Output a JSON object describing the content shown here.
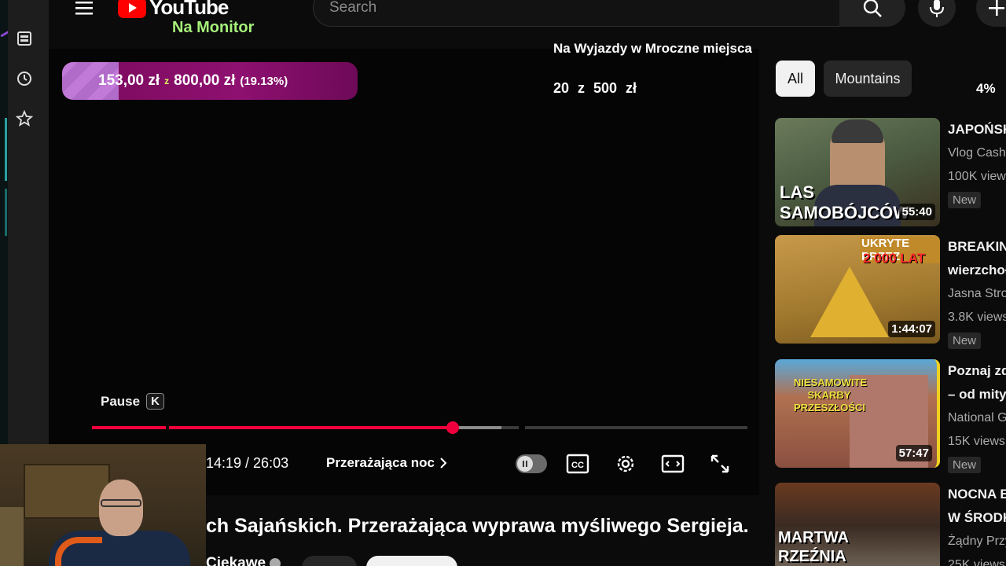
{
  "header": {
    "logo_word": "YouTube",
    "subbrand": "Na Monitor",
    "search_placeholder": "Search"
  },
  "goal_widget": {
    "current": "153,00 zł",
    "separator": "z",
    "target": "800,00 zł",
    "percent": "(19.13%)",
    "fraction": 0.1913
  },
  "overlay": {
    "title": "Na Wyjazdy w Mroczne miejsca",
    "goal": "20 z 500 zł",
    "percent": "4%"
  },
  "player": {
    "tooltip_label": "Pause",
    "tooltip_key": "K",
    "time": "14:19 / 26:03",
    "chapter": "Przerażająca noc",
    "played_fraction": 0.55,
    "buffered_fraction": 0.625
  },
  "chips": [
    {
      "label": "All"
    },
    {
      "label": "Mountains"
    }
  ],
  "recommendations": [
    {
      "title": "JAPOŃSK",
      "channel": "Vlog Casha",
      "views": "100K views",
      "badge": "New",
      "duration": "55:40",
      "thumb_text": "LAS SAMOBÓJCÓW"
    },
    {
      "title": "BREAKING",
      "title2": "wierzchoł",
      "channel": "Jasna Stro",
      "views": "3.8K views",
      "badge": "New",
      "duration": "1:44:07",
      "thumb_text": "UKRYTE PRZEZ",
      "thumb_text2": "2 000 LAT"
    },
    {
      "title": "Poznaj zd",
      "title2": "– od mity",
      "channel": "National Ge",
      "views": "15K views",
      "badge": "New",
      "duration": "57:47",
      "thumb_text": "NIESAMOWITE SKARBY PRZESZŁOŚCI"
    },
    {
      "title": "NOCNA E",
      "title2": "W ŚRODK",
      "channel": "Żądny Przy",
      "views": "25K views",
      "thumb_text": "MARTWA RZEŹNIA"
    }
  ],
  "video": {
    "title": "ch Sajańskich. Przerażająca wyprawa myśliwego Sergieja.",
    "channel": "Ciekawe"
  }
}
